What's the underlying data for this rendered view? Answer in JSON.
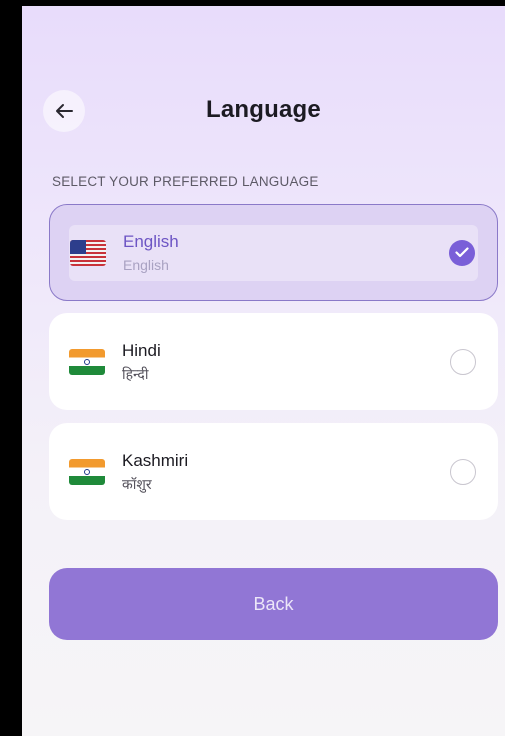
{
  "header": {
    "back_icon": "arrow-left-icon",
    "title": "Language"
  },
  "section": {
    "label": "SELECT YOUR PREFERRED LANGUAGE"
  },
  "languages": [
    {
      "name": "English",
      "native": "English",
      "flag_icon": "us-flag-icon",
      "selected": true
    },
    {
      "name": "Hindi",
      "native": "हिन्दी",
      "flag_icon": "india-flag-icon",
      "selected": false
    },
    {
      "name": "Kashmiri",
      "native": "कॉशुर",
      "flag_icon": "india-flag-icon",
      "selected": false
    }
  ],
  "footer": {
    "back_label": "Back"
  },
  "colors": {
    "accent": "#7a5fd8",
    "button": "#9176d5",
    "selected_card": "#ddd2f3"
  }
}
